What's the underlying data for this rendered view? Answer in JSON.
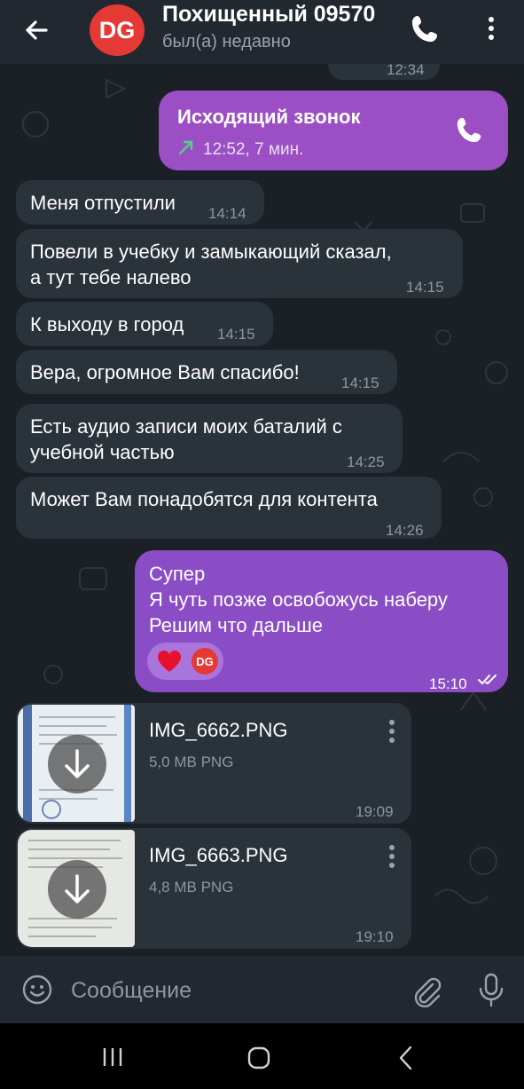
{
  "header": {
    "title": "Похищенный 09570",
    "status": "был(а) недавно",
    "avatar_initials": "DG",
    "avatar_color": "#e53935"
  },
  "messages": {
    "partial_time": "12:34",
    "call": {
      "title": "Исходящий звонок",
      "detail": "12:52, 7 мин."
    },
    "m1": {
      "text": "Меня отпустили",
      "time": "14:14"
    },
    "m2": {
      "text": "Повели в учебку и замыкающий сказал,\nа тут тебе налево",
      "time": "14:15"
    },
    "m3": {
      "text": "К выходу в город",
      "time": "14:15"
    },
    "m4": {
      "text": "Вера, огромное Вам спасибо!",
      "time": "14:15"
    },
    "m5": {
      "text": "Есть аудио записи моих баталий с\nучебной частью",
      "time": "14:25"
    },
    "m6": {
      "text": "Может Вам понадобятся для контента",
      "time": "14:26"
    },
    "out": {
      "text": "Супер\nЯ чуть позже освобожусь наберу\nРешим что дальше",
      "time": "15:10",
      "reaction_emoji": "heart",
      "reaction_avatar": "DG"
    },
    "file1": {
      "name": "IMG_6662.PNG",
      "size": "5,0 MB PNG",
      "time": "19:09"
    },
    "file2": {
      "name": "IMG_6663.PNG",
      "size": "4,8 MB PNG",
      "time": "19:10"
    }
  },
  "input": {
    "placeholder": "Сообщение"
  },
  "colors": {
    "outgoing_bubble": "#8a4dc6",
    "incoming_bubble": "#2a323a",
    "header": "#212830",
    "background": "#1a2026"
  }
}
